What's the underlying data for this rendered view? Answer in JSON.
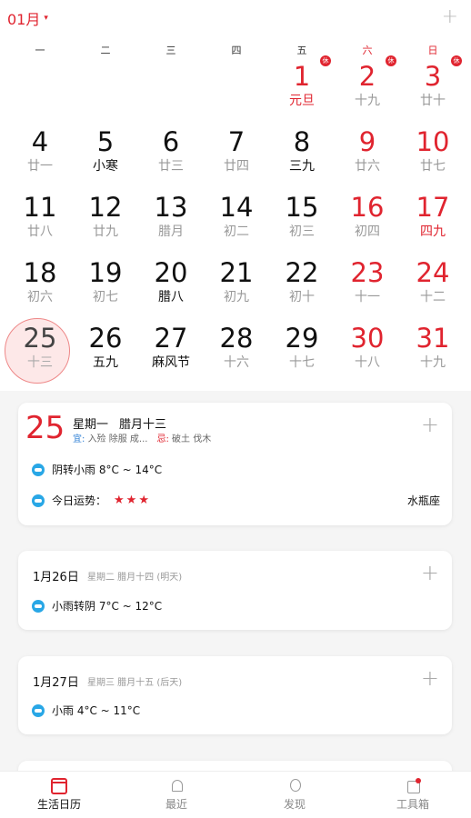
{
  "header": {
    "month_label": "01月",
    "caret": "▾",
    "add_icon": "+"
  },
  "weekdays": [
    {
      "label": "一",
      "red": false
    },
    {
      "label": "二",
      "red": false
    },
    {
      "label": "三",
      "red": false
    },
    {
      "label": "四",
      "red": false
    },
    {
      "label": "五",
      "red": false
    },
    {
      "label": "六",
      "red": true
    },
    {
      "label": "日",
      "red": true
    }
  ],
  "days": [
    {
      "day": "1",
      "lunar": "元旦",
      "red": true,
      "lunar_style": "redl",
      "rest": "休"
    },
    {
      "day": "2",
      "lunar": "十九",
      "red": true,
      "lunar_style": "",
      "rest": "休"
    },
    {
      "day": "3",
      "lunar": "廿十",
      "red": true,
      "lunar_style": "",
      "rest": "休"
    },
    {
      "day": "4",
      "lunar": "廿一",
      "red": false,
      "lunar_style": ""
    },
    {
      "day": "5",
      "lunar": "小寒",
      "red": false,
      "lunar_style": "festival"
    },
    {
      "day": "6",
      "lunar": "廿三",
      "red": false,
      "lunar_style": ""
    },
    {
      "day": "7",
      "lunar": "廿四",
      "red": false,
      "lunar_style": ""
    },
    {
      "day": "8",
      "lunar": "三九",
      "red": false,
      "lunar_style": "festival"
    },
    {
      "day": "9",
      "lunar": "廿六",
      "red": true,
      "lunar_style": ""
    },
    {
      "day": "10",
      "lunar": "廿七",
      "red": true,
      "lunar_style": ""
    },
    {
      "day": "11",
      "lunar": "廿八",
      "red": false,
      "lunar_style": ""
    },
    {
      "day": "12",
      "lunar": "廿九",
      "red": false,
      "lunar_style": ""
    },
    {
      "day": "13",
      "lunar": "腊月",
      "red": false,
      "lunar_style": ""
    },
    {
      "day": "14",
      "lunar": "初二",
      "red": false,
      "lunar_style": ""
    },
    {
      "day": "15",
      "lunar": "初三",
      "red": false,
      "lunar_style": ""
    },
    {
      "day": "16",
      "lunar": "初四",
      "red": true,
      "lunar_style": ""
    },
    {
      "day": "17",
      "lunar": "四九",
      "red": true,
      "lunar_style": "redl"
    },
    {
      "day": "18",
      "lunar": "初六",
      "red": false,
      "lunar_style": ""
    },
    {
      "day": "19",
      "lunar": "初七",
      "red": false,
      "lunar_style": ""
    },
    {
      "day": "20",
      "lunar": "腊八",
      "red": false,
      "lunar_style": "festival"
    },
    {
      "day": "21",
      "lunar": "初九",
      "red": false,
      "lunar_style": ""
    },
    {
      "day": "22",
      "lunar": "初十",
      "red": false,
      "lunar_style": ""
    },
    {
      "day": "23",
      "lunar": "十一",
      "red": true,
      "lunar_style": ""
    },
    {
      "day": "24",
      "lunar": "十二",
      "red": true,
      "lunar_style": ""
    },
    {
      "day": "25",
      "lunar": "十三",
      "red": false,
      "lunar_style": "",
      "today": true
    },
    {
      "day": "26",
      "lunar": "五九",
      "red": false,
      "lunar_style": "festival"
    },
    {
      "day": "27",
      "lunar": "麻风节",
      "red": false,
      "lunar_style": "festival"
    },
    {
      "day": "28",
      "lunar": "十六",
      "red": false,
      "lunar_style": ""
    },
    {
      "day": "29",
      "lunar": "十七",
      "red": false,
      "lunar_style": ""
    },
    {
      "day": "30",
      "lunar": "十八",
      "red": true,
      "lunar_style": ""
    },
    {
      "day": "31",
      "lunar": "十九",
      "red": true,
      "lunar_style": ""
    }
  ],
  "first_weekday_index": 4,
  "today_card": {
    "day": "25",
    "weekday": "星期一",
    "lunar": "腊月十三",
    "yi_label": "宜:",
    "yi_text": "入殓 除服 成...",
    "ji_label": "忌:",
    "ji_text": "破土 伐木",
    "weather": "阴转小雨  8°C ~ 14°C",
    "fortune_label": "今日运势：",
    "stars": "★★★",
    "zodiac": "水瓶座",
    "plus": "+"
  },
  "forecast": [
    {
      "date": "1月26日",
      "sub": "星期二   腊月十四 (明天)",
      "weather": "小雨转阴  7°C ~ 12°C",
      "plus": "+"
    },
    {
      "date": "1月27日",
      "sub": "星期三   腊月十五 (后天)",
      "weather": "小雨  4°C ~ 11°C",
      "plus": "+"
    }
  ],
  "tabs": [
    {
      "label": "生活日历",
      "icon": "calendar-icon",
      "active": true
    },
    {
      "label": "最近",
      "icon": "bell-icon",
      "active": false
    },
    {
      "label": "发现",
      "icon": "bulb-icon",
      "active": false
    },
    {
      "label": "工具箱",
      "icon": "toolbox-icon",
      "active": false
    }
  ],
  "colors": {
    "accent": "#e0242f",
    "weather_icon": "#29a7e6"
  }
}
